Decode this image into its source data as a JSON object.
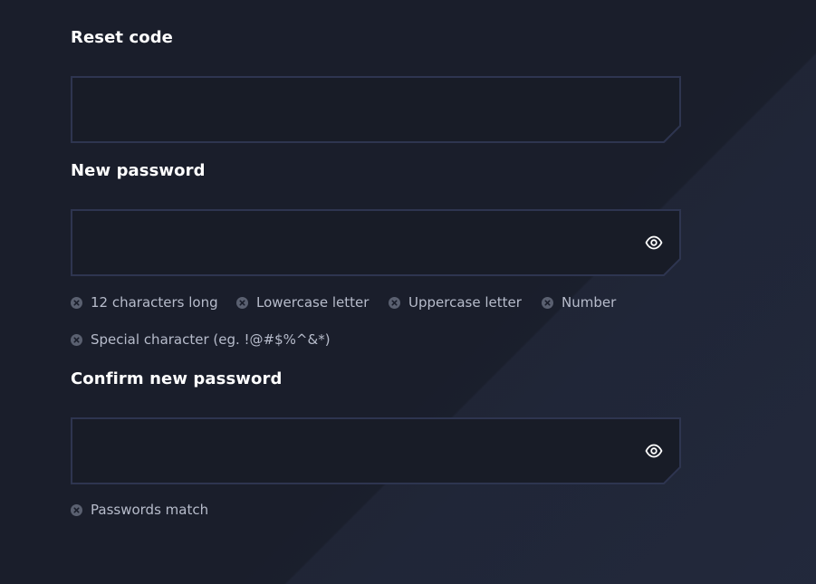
{
  "form": {
    "reset_code": {
      "label": "Reset code",
      "value": "",
      "placeholder": ""
    },
    "new_password": {
      "label": "New password",
      "value": "",
      "placeholder": "",
      "toggle_icon": "eye-icon"
    },
    "password_requirements": [
      {
        "label": "12 characters long",
        "met": false,
        "icon": "x-circle-icon"
      },
      {
        "label": "Lowercase letter",
        "met": false,
        "icon": "x-circle-icon"
      },
      {
        "label": "Uppercase letter",
        "met": false,
        "icon": "x-circle-icon"
      },
      {
        "label": "Number",
        "met": false,
        "icon": "x-circle-icon"
      },
      {
        "label": "Special character (eg. !@#$%^&*)",
        "met": false,
        "icon": "x-circle-icon"
      }
    ],
    "confirm_password": {
      "label": "Confirm new password",
      "value": "",
      "placeholder": "",
      "toggle_icon": "eye-icon"
    },
    "confirm_requirements": [
      {
        "label": "Passwords match",
        "met": false,
        "icon": "x-circle-icon"
      }
    ]
  },
  "colors": {
    "background": "#1a1e2b",
    "field_fill": "#181c27",
    "field_border": "#2e3550",
    "label_text": "#ffffff",
    "requirement_text": "#b7bccb",
    "requirement_icon": "#5a6070"
  }
}
